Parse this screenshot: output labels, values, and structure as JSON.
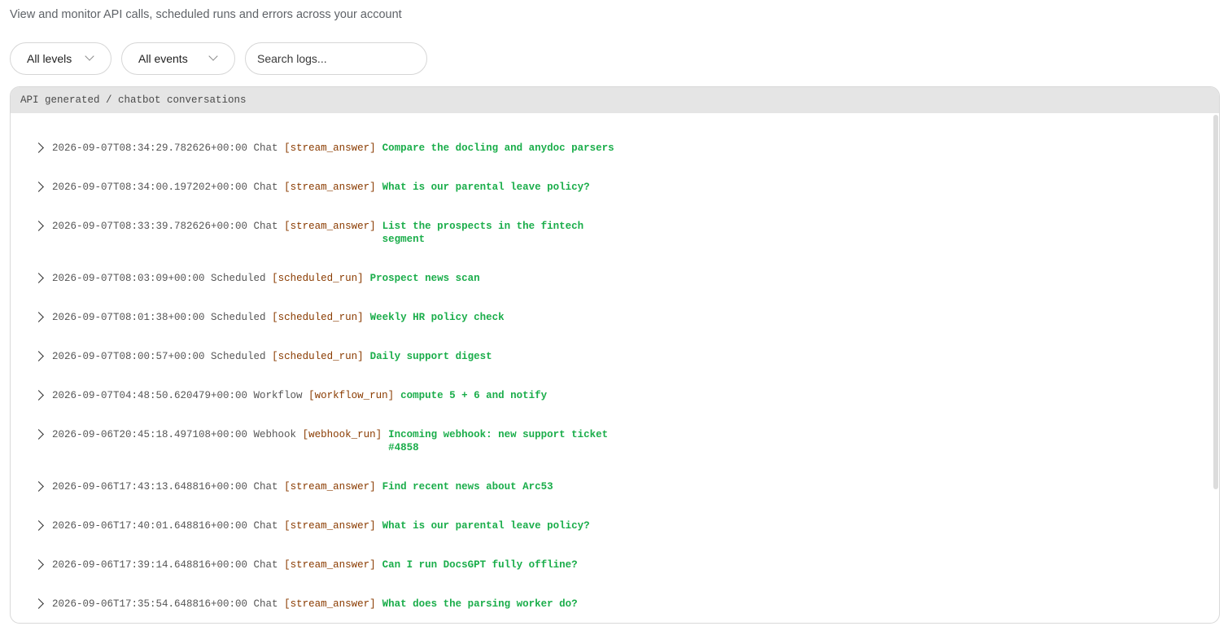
{
  "header": {
    "subtitle": "View and monitor API calls, scheduled runs and errors across your account"
  },
  "filters": {
    "level_value": "All levels",
    "event_value": "All events",
    "search_placeholder": "Search logs..."
  },
  "panel": {
    "title": "API generated / chatbot conversations"
  },
  "logs": [
    {
      "timestamp": "2026-09-07T08:34:29.782626+00:00",
      "source": "Chat",
      "tag": "[stream_answer]",
      "message": [
        "Compare the docling and anydoc parsers"
      ]
    },
    {
      "timestamp": "2026-09-07T08:34:00.197202+00:00",
      "source": "Chat",
      "tag": "[stream_answer]",
      "message": [
        "What is our parental leave policy?"
      ]
    },
    {
      "timestamp": "2026-09-07T08:33:39.782626+00:00",
      "source": "Chat",
      "tag": "[stream_answer]",
      "message": [
        "List the prospects in the fintech",
        "segment"
      ]
    },
    {
      "timestamp": "2026-09-07T08:03:09+00:00",
      "source": "Scheduled",
      "tag": "[scheduled_run]",
      "message": [
        "Prospect news scan"
      ]
    },
    {
      "timestamp": "2026-09-07T08:01:38+00:00",
      "source": "Scheduled",
      "tag": "[scheduled_run]",
      "message": [
        "Weekly HR policy check"
      ]
    },
    {
      "timestamp": "2026-09-07T08:00:57+00:00",
      "source": "Scheduled",
      "tag": "[scheduled_run]",
      "message": [
        "Daily support digest"
      ]
    },
    {
      "timestamp": "2026-09-07T04:48:50.620479+00:00",
      "source": "Workflow",
      "tag": "[workflow_run]",
      "message": [
        "compute 5 + 6 and notify"
      ]
    },
    {
      "timestamp": "2026-09-06T20:45:18.497108+00:00",
      "source": "Webhook",
      "tag": "[webhook_run]",
      "message": [
        "Incoming webhook: new support ticket",
        "#4858"
      ]
    },
    {
      "timestamp": "2026-09-06T17:43:13.648816+00:00",
      "source": "Chat",
      "tag": "[stream_answer]",
      "message": [
        "Find recent news about Arc53"
      ]
    },
    {
      "timestamp": "2026-09-06T17:40:01.648816+00:00",
      "source": "Chat",
      "tag": "[stream_answer]",
      "message": [
        "What is our parental leave policy?"
      ]
    },
    {
      "timestamp": "2026-09-06T17:39:14.648816+00:00",
      "source": "Chat",
      "tag": "[stream_answer]",
      "message": [
        "Can I run DocsGPT fully offline?"
      ]
    },
    {
      "timestamp": "2026-09-06T17:35:54.648816+00:00",
      "source": "Chat",
      "tag": "[stream_answer]",
      "message": [
        "What does the parsing worker do?"
      ]
    }
  ],
  "colors": {
    "tag": "#8a3b00",
    "message": "#1aad4a",
    "panel_header_bg": "#e5e5e5"
  }
}
